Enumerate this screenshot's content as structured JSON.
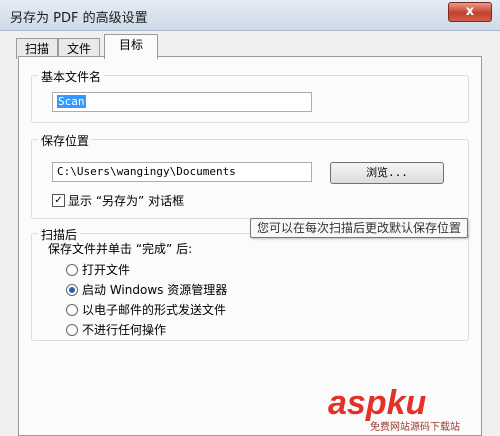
{
  "window": {
    "title": "另存为 PDF 的高级设置",
    "close_glyph": "x"
  },
  "tabs": [
    {
      "label": "扫描",
      "active": false
    },
    {
      "label": "文件",
      "active": false
    },
    {
      "label": "目标",
      "active": true
    }
  ],
  "basename": {
    "legend": "基本文件名",
    "value": "Scan"
  },
  "location": {
    "legend": "保存位置",
    "path": "C:\\Users\\wangingy\\Documents",
    "browse_label": "浏览...",
    "show_dialog_label": "显示 “另存为” 对话框",
    "show_dialog_checked": true
  },
  "after_scan": {
    "legend": "扫描后",
    "prompt": "保存文件并单击 “完成” 后:",
    "options": [
      {
        "label": "打开文件",
        "selected": false
      },
      {
        "label": "启动 Windows 资源管理器",
        "selected": true
      },
      {
        "label": "以电子邮件的形式发送文件",
        "selected": false
      },
      {
        "label": "不进行任何操作",
        "selected": false
      }
    ]
  },
  "tooltip": "您可以在每次扫描后更改默认保存位置",
  "watermark": {
    "main": "aspku",
    "sub": "免费网站源码下载站"
  }
}
